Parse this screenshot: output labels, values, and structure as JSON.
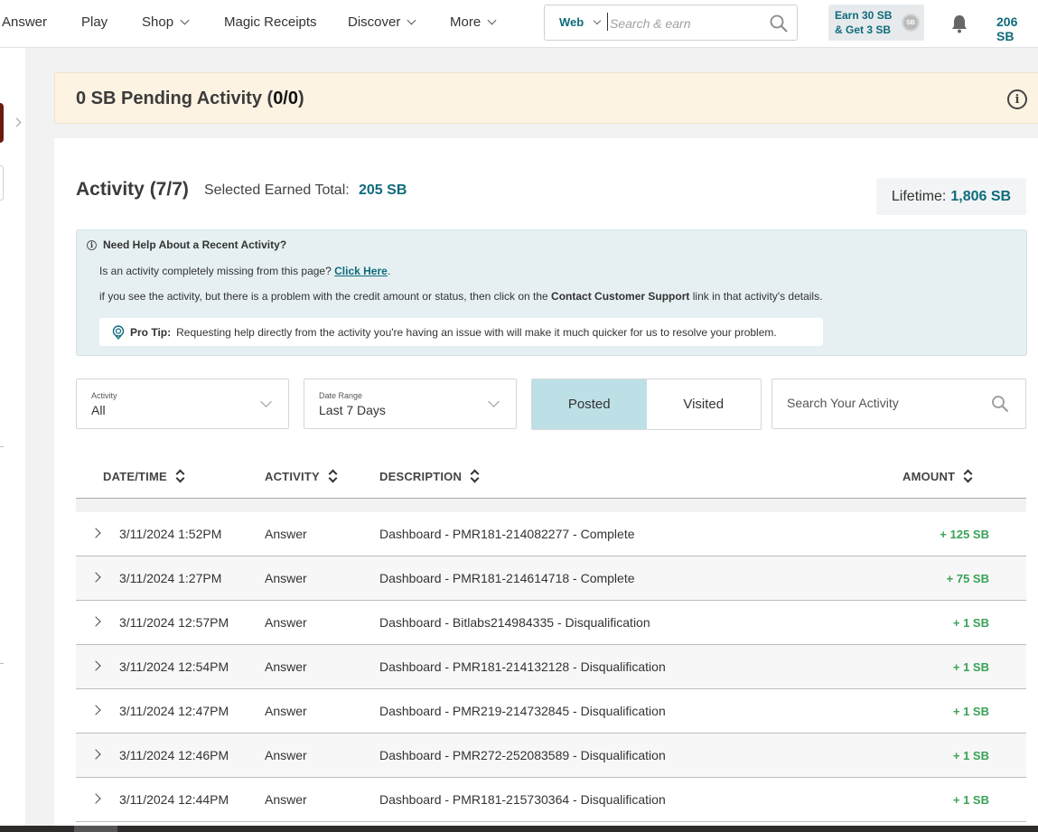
{
  "nav": {
    "items": [
      {
        "label": "Answer",
        "dropdown": false
      },
      {
        "label": "Play",
        "dropdown": false
      },
      {
        "label": "Shop",
        "dropdown": true
      },
      {
        "label": "Magic Receipts",
        "dropdown": false
      },
      {
        "label": "Discover",
        "dropdown": true
      },
      {
        "label": "More",
        "dropdown": true
      }
    ],
    "search": {
      "scope": "Web",
      "placeholder": "Search & earn"
    },
    "earn": {
      "line1": "Earn 30 SB",
      "line2": "& Get 3 SB",
      "coin": "SB"
    },
    "balance": "206 SB"
  },
  "pending": {
    "prefix": "0 SB Pending Activity (",
    "count": "0/0",
    "suffix": ")"
  },
  "activity": {
    "title": "Activity (7/7)",
    "selected_label": "Selected Earned Total:",
    "selected_value": "205 SB",
    "lifetime_label": "Lifetime:",
    "lifetime_value": "1,806 SB"
  },
  "help": {
    "title": "Need Help About a Recent Activity?",
    "line1_text": "Is an activity completely missing from this page?",
    "line1_link": "Click Here",
    "line2_pre": "if you see the activity, but there is a problem with the credit amount or status, then click on the",
    "line2_bold": "Contact Customer Support",
    "line2_post": "link in that activity's details.",
    "protip_label": "Pro Tip:",
    "protip_text": "Requesting help directly from the activity you're having an issue with will make it much quicker for us to resolve your problem."
  },
  "filters": {
    "activity_label": "Activity",
    "activity_value": "All",
    "date_label": "Date Range",
    "date_value": "Last 7 Days",
    "toggle": [
      "Posted",
      "Visited"
    ],
    "active_toggle": "Posted",
    "search_placeholder": "Search Your Activity"
  },
  "table": {
    "headers": [
      "DATE/TIME",
      "ACTIVITY",
      "DESCRIPTION",
      "AMOUNT"
    ],
    "rows": [
      {
        "datetime": "3/11/2024 1:52PM",
        "activity": "Answer",
        "description": "Dashboard - PMR181-214082277 - Complete",
        "amount": "+ 125 SB"
      },
      {
        "datetime": "3/11/2024 1:27PM",
        "activity": "Answer",
        "description": "Dashboard - PMR181-214614718 - Complete",
        "amount": "+ 75 SB"
      },
      {
        "datetime": "3/11/2024 12:57PM",
        "activity": "Answer",
        "description": "Dashboard - Bitlabs214984335 - Disqualification",
        "amount": "+ 1 SB"
      },
      {
        "datetime": "3/11/2024 12:54PM",
        "activity": "Answer",
        "description": "Dashboard - PMR181-214132128 - Disqualification",
        "amount": "+ 1 SB"
      },
      {
        "datetime": "3/11/2024 12:47PM",
        "activity": "Answer",
        "description": "Dashboard - PMR219-214732845 - Disqualification",
        "amount": "+ 1 SB"
      },
      {
        "datetime": "3/11/2024 12:46PM",
        "activity": "Answer",
        "description": "Dashboard - PMR272-252083589 - Disqualification",
        "amount": "+ 1 SB"
      },
      {
        "datetime": "3/11/2024 12:44PM",
        "activity": "Answer",
        "description": "Dashboard - PMR181-215730364 - Disqualification",
        "amount": "+ 1 SB"
      }
    ]
  },
  "colors": {
    "accent": "#0f6b7b",
    "positive": "#3aa357",
    "pending_bg": "#fdf3e2",
    "help_bg": "#e6f0f2",
    "toggle_active": "#bde0e6"
  }
}
